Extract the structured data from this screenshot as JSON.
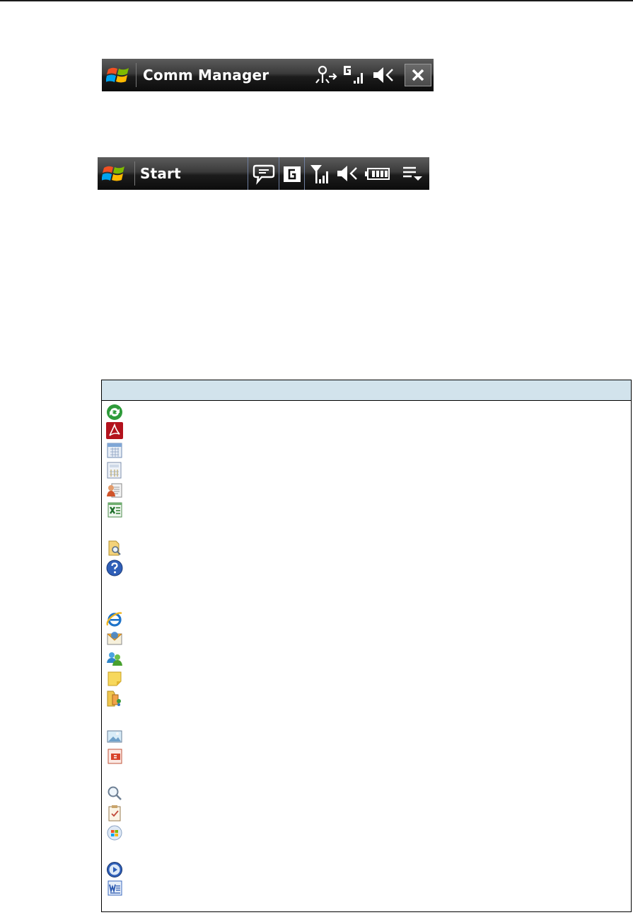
{
  "titlebars": [
    {
      "title": "Comm Manager",
      "icons": [
        "windows-logo",
        "connection-icon",
        "gprs-signal-icon",
        "speaker-muted-icon",
        "close-icon"
      ]
    },
    {
      "title": "Start",
      "icons": [
        "windows-logo",
        "notification-bubble-icon",
        "gprs-icon",
        "signal-icon",
        "speaker-muted-icon",
        "battery-icon",
        "list-menu-icon"
      ]
    }
  ],
  "icon_table": {
    "header": "",
    "icons": [
      "activesync-icon",
      "adobe-reader-icon",
      "calendar-icon",
      "calculator-icon",
      "contacts-icon",
      "excel-mobile-icon",
      "file-explorer-icon",
      "help-icon",
      "internet-explorer-icon",
      "messaging-icon",
      "messenger-icon",
      "notes-icon",
      "phone-folder-icon",
      "pictures-icon",
      "powerpoint-mobile-icon",
      "search-icon",
      "tasks-icon",
      "windows-live-icon",
      "media-player-icon",
      "word-mobile-icon"
    ]
  },
  "colors": {
    "table_header": "#d2e3ec",
    "titlebar_top": "#5c5c5c",
    "titlebar_bottom": "#0c0c0c"
  }
}
